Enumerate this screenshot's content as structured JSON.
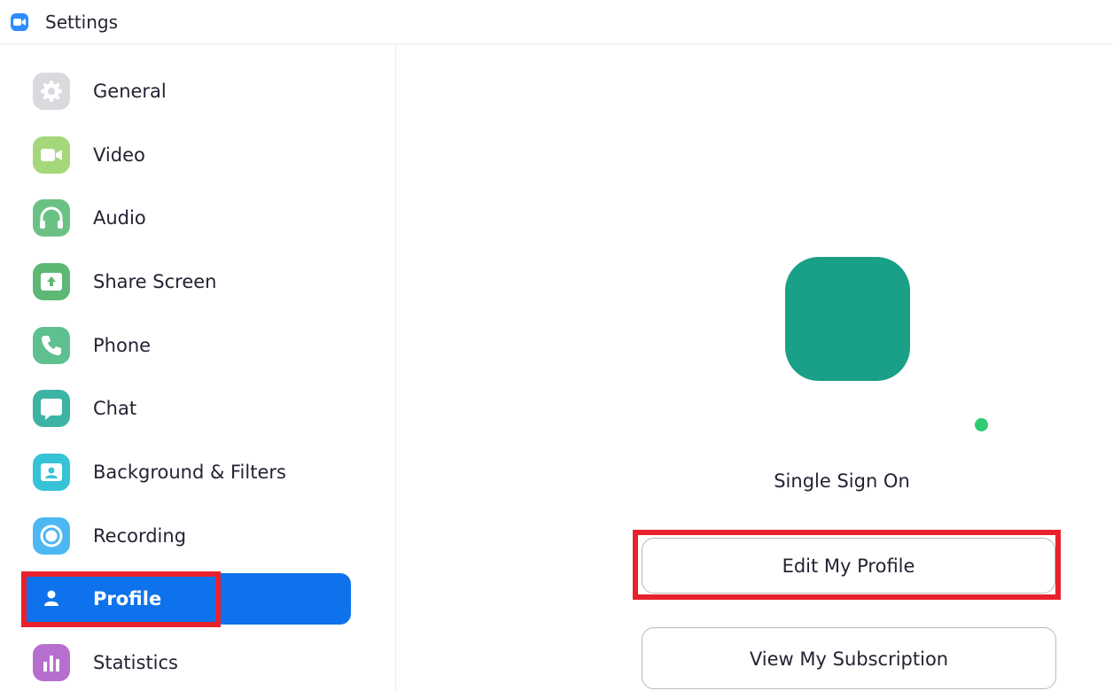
{
  "window": {
    "title": "Settings"
  },
  "sidebar": {
    "items": [
      {
        "label": "General",
        "icon": "gear-icon",
        "color": "#d9d9de",
        "active": false
      },
      {
        "label": "Video",
        "icon": "video-camera-icon",
        "color": "#a4d87a",
        "active": false
      },
      {
        "label": "Audio",
        "icon": "headphones-icon",
        "color": "#6bc183",
        "active": false
      },
      {
        "label": "Share Screen",
        "icon": "share-screen-icon",
        "color": "#5cb874",
        "active": false
      },
      {
        "label": "Phone",
        "icon": "phone-icon",
        "color": "#5fc08f",
        "active": false
      },
      {
        "label": "Chat",
        "icon": "chat-bubble-icon",
        "color": "#3db3a4",
        "active": false
      },
      {
        "label": "Background & Filters",
        "icon": "background-portrait-icon",
        "color": "#36c2d7",
        "active": false
      },
      {
        "label": "Recording",
        "icon": "record-icon",
        "color": "#4db7f2",
        "active": false
      },
      {
        "label": "Profile",
        "icon": "person-icon",
        "color": "#0e72ed",
        "active": true
      },
      {
        "label": "Statistics",
        "icon": "bar-chart-icon",
        "color": "#b66fcf",
        "active": false
      }
    ]
  },
  "profile": {
    "avatar_color": "#19a087",
    "status_color": "#2ecc71",
    "login_type": "Single Sign On",
    "edit_button": "Edit My Profile",
    "subscription_button": "View My Subscription"
  },
  "highlight_color": "#e8212c"
}
